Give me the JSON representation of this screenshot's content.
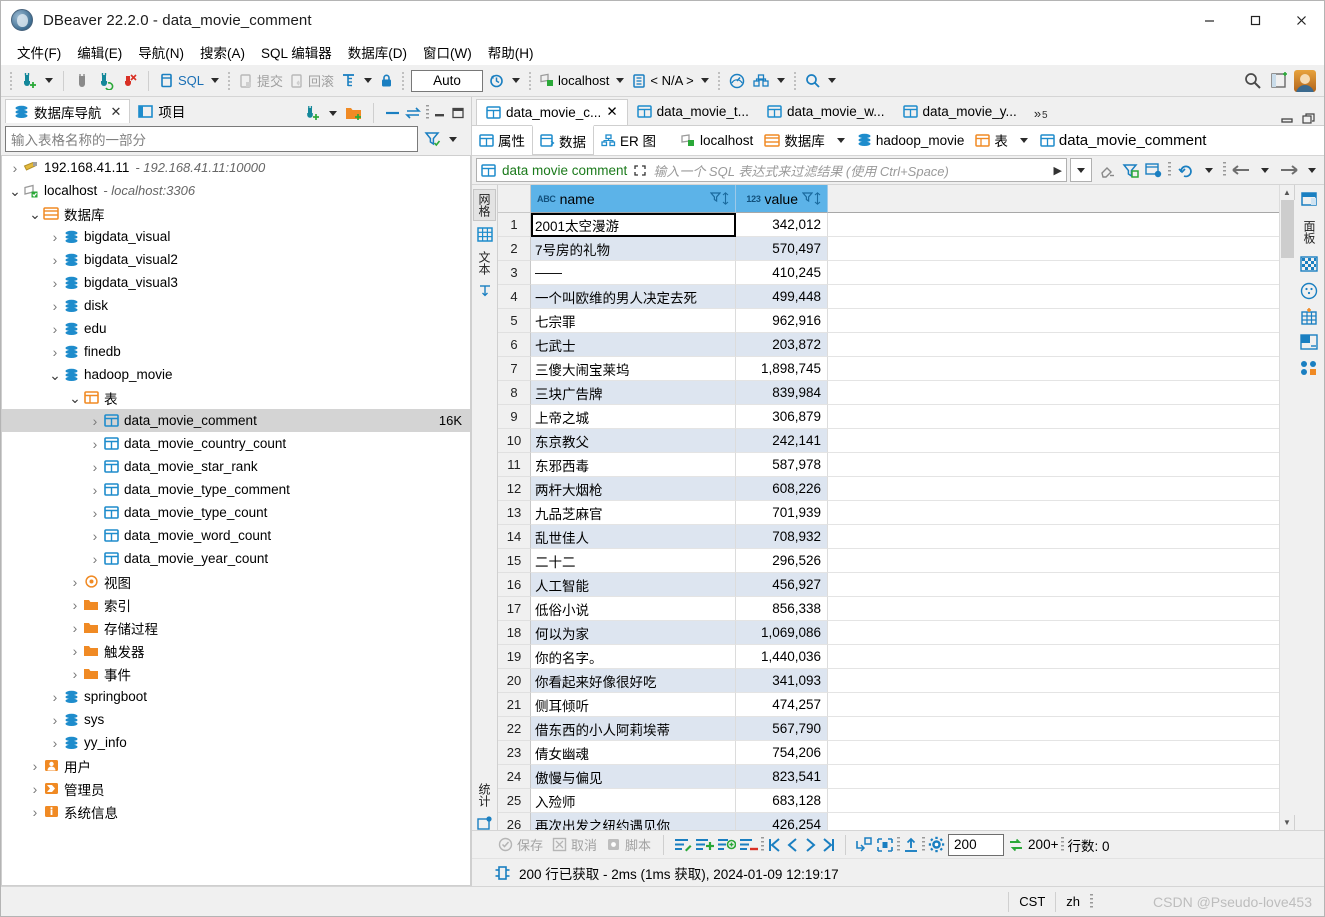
{
  "window": {
    "title": "DBeaver 22.2.0 - data_movie_comment",
    "app_icon": "dbeaver-icon",
    "minimize": "‒",
    "maximize": "▢",
    "close": "✕"
  },
  "menubar": {
    "items": [
      "文件(F)",
      "编辑(E)",
      "导航(N)",
      "搜索(A)",
      "SQL 编辑器",
      "数据库(D)",
      "窗口(W)",
      "帮助(H)"
    ]
  },
  "toolbar": {
    "sql_label": "SQL",
    "commit_label": "提交",
    "rollback_label": "回滚",
    "auto_label": "Auto",
    "connection_label": "localhost",
    "database_label": "< N/A >",
    "icons": [
      "new-connection-icon",
      "disconnect-icon",
      "refresh-connection-icon",
      "reject-icon",
      "sql-editor-icon",
      "commit-icon",
      "rollback-icon",
      "transaction-mode-icon",
      "lock-icon",
      "history-icon",
      "connection-icon",
      "schema-icon",
      "dashboard-icon",
      "task-icon",
      "search-icon"
    ]
  },
  "navigator": {
    "tabs": [
      {
        "label": "数据库导航",
        "icon": "database-navigator-icon",
        "active": true,
        "closable": true
      },
      {
        "label": "项目",
        "icon": "project-icon",
        "active": false,
        "closable": false
      }
    ],
    "tools": [
      "new-connection-icon",
      "new-folder-icon",
      "collapse-all-icon",
      "link-editor-icon",
      "view-menu-icon",
      "minimize-icon",
      "maximize-icon"
    ],
    "filter_placeholder": "输入表格名称的一部分",
    "filter_icons": [
      "filter-icon",
      "filter-menu-icon"
    ],
    "tree": [
      {
        "level": 0,
        "arrow": "collapsed",
        "icon": "connection-offline-icon",
        "label": "192.168.41.11",
        "sub": "- 192.168.41.11:10000"
      },
      {
        "level": 0,
        "arrow": "expanded",
        "icon": "connection-online-icon",
        "label": "localhost",
        "sub": "- localhost:3306"
      },
      {
        "level": 1,
        "arrow": "expanded",
        "icon": "databases-folder-icon",
        "label": "数据库",
        "sub": ""
      },
      {
        "level": 2,
        "arrow": "collapsed",
        "icon": "database-icon",
        "label": "bigdata_visual",
        "sub": ""
      },
      {
        "level": 2,
        "arrow": "collapsed",
        "icon": "database-icon",
        "label": "bigdata_visual2",
        "sub": ""
      },
      {
        "level": 2,
        "arrow": "collapsed",
        "icon": "database-icon",
        "label": "bigdata_visual3",
        "sub": ""
      },
      {
        "level": 2,
        "arrow": "collapsed",
        "icon": "database-icon",
        "label": "disk",
        "sub": ""
      },
      {
        "level": 2,
        "arrow": "collapsed",
        "icon": "database-icon",
        "label": "edu",
        "sub": ""
      },
      {
        "level": 2,
        "arrow": "collapsed",
        "icon": "database-icon",
        "label": "finedb",
        "sub": ""
      },
      {
        "level": 2,
        "arrow": "expanded",
        "icon": "database-icon",
        "label": "hadoop_movie",
        "sub": ""
      },
      {
        "level": 3,
        "arrow": "expanded",
        "icon": "tables-folder-icon",
        "label": "表",
        "sub": ""
      },
      {
        "level": 4,
        "arrow": "collapsed",
        "icon": "table-icon",
        "label": "data_movie_comment",
        "sub": "",
        "size": "16K",
        "selected": true
      },
      {
        "level": 4,
        "arrow": "collapsed",
        "icon": "table-icon",
        "label": "data_movie_country_count",
        "sub": ""
      },
      {
        "level": 4,
        "arrow": "collapsed",
        "icon": "table-icon",
        "label": "data_movie_star_rank",
        "sub": ""
      },
      {
        "level": 4,
        "arrow": "collapsed",
        "icon": "table-icon",
        "label": "data_movie_type_comment",
        "sub": ""
      },
      {
        "level": 4,
        "arrow": "collapsed",
        "icon": "table-icon",
        "label": "data_movie_type_count",
        "sub": ""
      },
      {
        "level": 4,
        "arrow": "collapsed",
        "icon": "table-icon",
        "label": "data_movie_word_count",
        "sub": ""
      },
      {
        "level": 4,
        "arrow": "collapsed",
        "icon": "table-icon",
        "label": "data_movie_year_count",
        "sub": ""
      },
      {
        "level": 3,
        "arrow": "collapsed",
        "icon": "view-icon",
        "label": "视图",
        "sub": ""
      },
      {
        "level": 3,
        "arrow": "collapsed",
        "icon": "folder-icon",
        "label": "索引",
        "sub": ""
      },
      {
        "level": 3,
        "arrow": "collapsed",
        "icon": "folder-icon",
        "label": "存储过程",
        "sub": ""
      },
      {
        "level": 3,
        "arrow": "collapsed",
        "icon": "folder-icon",
        "label": "触发器",
        "sub": ""
      },
      {
        "level": 3,
        "arrow": "collapsed",
        "icon": "folder-icon",
        "label": "事件",
        "sub": ""
      },
      {
        "level": 2,
        "arrow": "collapsed",
        "icon": "database-icon",
        "label": "springboot",
        "sub": ""
      },
      {
        "level": 2,
        "arrow": "collapsed",
        "icon": "database-icon",
        "label": "sys",
        "sub": ""
      },
      {
        "level": 2,
        "arrow": "collapsed",
        "icon": "database-icon",
        "label": "yy_info",
        "sub": ""
      },
      {
        "level": 1,
        "arrow": "collapsed",
        "icon": "users-icon",
        "label": "用户",
        "sub": ""
      },
      {
        "level": 1,
        "arrow": "collapsed",
        "icon": "admin-icon",
        "label": "管理员",
        "sub": ""
      },
      {
        "level": 1,
        "arrow": "collapsed",
        "icon": "system-info-icon",
        "label": "系统信息",
        "sub": ""
      }
    ]
  },
  "editor": {
    "tabs": [
      {
        "label": "data_movie_c...",
        "icon": "table-icon",
        "active": true,
        "closable": true
      },
      {
        "label": "data_movie_t...",
        "icon": "table-icon",
        "active": false,
        "closable": false
      },
      {
        "label": "data_movie_w...",
        "icon": "table-icon",
        "active": false,
        "closable": false
      },
      {
        "label": "data_movie_y...",
        "icon": "table-icon",
        "active": false,
        "closable": false
      }
    ],
    "overflow_label": "»",
    "overflow_count": "5",
    "window_controls": [
      "restore-icon",
      "maximize-icon"
    ],
    "subtabs": [
      {
        "label": "属性",
        "icon": "properties-icon",
        "active": false
      },
      {
        "label": "数据",
        "icon": "data-icon",
        "active": true
      },
      {
        "label": "ER 图",
        "icon": "er-diagram-icon",
        "active": false
      }
    ],
    "breadcrumb": [
      {
        "label": "localhost",
        "icon": "connection-online-icon",
        "dropdown": false
      },
      {
        "label": "数据库",
        "icon": "databases-folder-icon",
        "dropdown": true
      },
      {
        "label": "hadoop_movie",
        "icon": "database-icon",
        "dropdown": true
      },
      {
        "label": "表",
        "icon": "tables-folder-icon",
        "dropdown": true
      },
      {
        "label": "data_movie_comment",
        "icon": "table-icon",
        "dropdown": false
      }
    ]
  },
  "filterbar": {
    "table_name": "data movie comment",
    "placeholder": "输入一个 SQL 表达式来过滤结果 (使用 Ctrl+Space)",
    "expand_icon": "expand-icon",
    "history_icon": "history-dropdown-icon",
    "icons": [
      "clear-filter-icon",
      "apply-filter-icon",
      "custom-filter-icon",
      "refresh-icon",
      "back-icon",
      "back-menu-icon",
      "forward-icon",
      "forward-menu-icon"
    ]
  },
  "left_vtabs": [
    {
      "label": "网格",
      "icon": "grid-icon",
      "selected": true
    },
    {
      "label": "文本",
      "icon": "text-icon",
      "selected": false
    },
    {
      "label": "统计",
      "icon": "calc-icon",
      "selected": false
    }
  ],
  "right_vtabs": [
    {
      "label": "面板",
      "icon": "panels-icon"
    },
    {
      "icon": "grid-config-icon"
    },
    {
      "icon": "record-icon"
    },
    {
      "icon": "calc-grid-icon"
    },
    {
      "icon": "split-panel-icon"
    },
    {
      "icon": "toggle-options-icon"
    }
  ],
  "grid": {
    "columns": [
      {
        "name": "name",
        "type_badge": "ABC",
        "align": "left"
      },
      {
        "name": "value",
        "type_badge": "123",
        "align": "right"
      }
    ],
    "focused_cell": {
      "row": 1,
      "column": "name"
    },
    "rows": [
      {
        "n": 1,
        "name": "2001太空漫游",
        "value": "342,012"
      },
      {
        "n": 2,
        "name": "7号房的礼物",
        "value": "570,497"
      },
      {
        "n": 3,
        "name": "——",
        "value": "410,245"
      },
      {
        "n": 4,
        "name": "一个叫欧维的男人决定去死",
        "value": "499,448"
      },
      {
        "n": 5,
        "name": "七宗罪",
        "value": "962,916"
      },
      {
        "n": 6,
        "name": "七武士",
        "value": "203,872"
      },
      {
        "n": 7,
        "name": "三傻大闹宝莱坞",
        "value": "1,898,745"
      },
      {
        "n": 8,
        "name": "三块广告牌",
        "value": "839,984"
      },
      {
        "n": 9,
        "name": "上帝之城",
        "value": "306,879"
      },
      {
        "n": 10,
        "name": "东京教父",
        "value": "242,141"
      },
      {
        "n": 11,
        "name": "东邪西毒",
        "value": "587,978"
      },
      {
        "n": 12,
        "name": "两杆大烟枪",
        "value": "608,226"
      },
      {
        "n": 13,
        "name": "九品芝麻官",
        "value": "701,939"
      },
      {
        "n": 14,
        "name": "乱世佳人",
        "value": "708,932"
      },
      {
        "n": 15,
        "name": "二十二",
        "value": "296,526"
      },
      {
        "n": 16,
        "name": "人工智能",
        "value": "456,927"
      },
      {
        "n": 17,
        "name": "低俗小说",
        "value": "856,338"
      },
      {
        "n": 18,
        "name": "何以为家",
        "value": "1,069,086"
      },
      {
        "n": 19,
        "name": "你的名字。",
        "value": "1,440,036"
      },
      {
        "n": 20,
        "name": "你看起来好像很好吃",
        "value": "341,093"
      },
      {
        "n": 21,
        "name": "侧耳倾听",
        "value": "474,257"
      },
      {
        "n": 22,
        "name": "借东西的小人阿莉埃蒂",
        "value": "567,790"
      },
      {
        "n": 23,
        "name": "倩女幽魂",
        "value": "754,206"
      },
      {
        "n": 24,
        "name": "傲慢与偏见",
        "value": "823,541"
      },
      {
        "n": 25,
        "name": "入殓师",
        "value": "683,128"
      },
      {
        "n": 26,
        "name": "再次出发之纽约遇见你",
        "value": "426,254"
      }
    ]
  },
  "grid_toolbar": {
    "save_label": "保存",
    "cancel_label": "取消",
    "script_label": "脚本",
    "fetch_size": "200",
    "fetched_label": "200+",
    "rowcount_label": "行数: 0",
    "icons": [
      "save-icon",
      "cancel-icon",
      "script-icon",
      "edit-row-icon",
      "add-row-icon",
      "duplicate-row-icon",
      "delete-row-icon",
      "first-page-icon",
      "prev-page-icon",
      "next-page-icon",
      "last-page-icon",
      "fetch-next-icon",
      "fetch-all-icon",
      "export-icon",
      "settings-icon",
      "refresh-rows-icon"
    ]
  },
  "status": {
    "fetch_message": "200 行已获取 - 2ms (1ms 获取), 2024-01-09 12:19:17",
    "fetch_icon": "result-icon",
    "timezone": "CST",
    "locale": "zh",
    "watermark": "CSDN @Pseudo-love453"
  },
  "colors": {
    "accent_blue": "#1e8ccc",
    "header_blue": "#5cb3e8",
    "row_alt": "#dde5f0",
    "orange": "#f08a24",
    "green": "#1b7a1b",
    "panel_bg": "#f0f0f0"
  }
}
